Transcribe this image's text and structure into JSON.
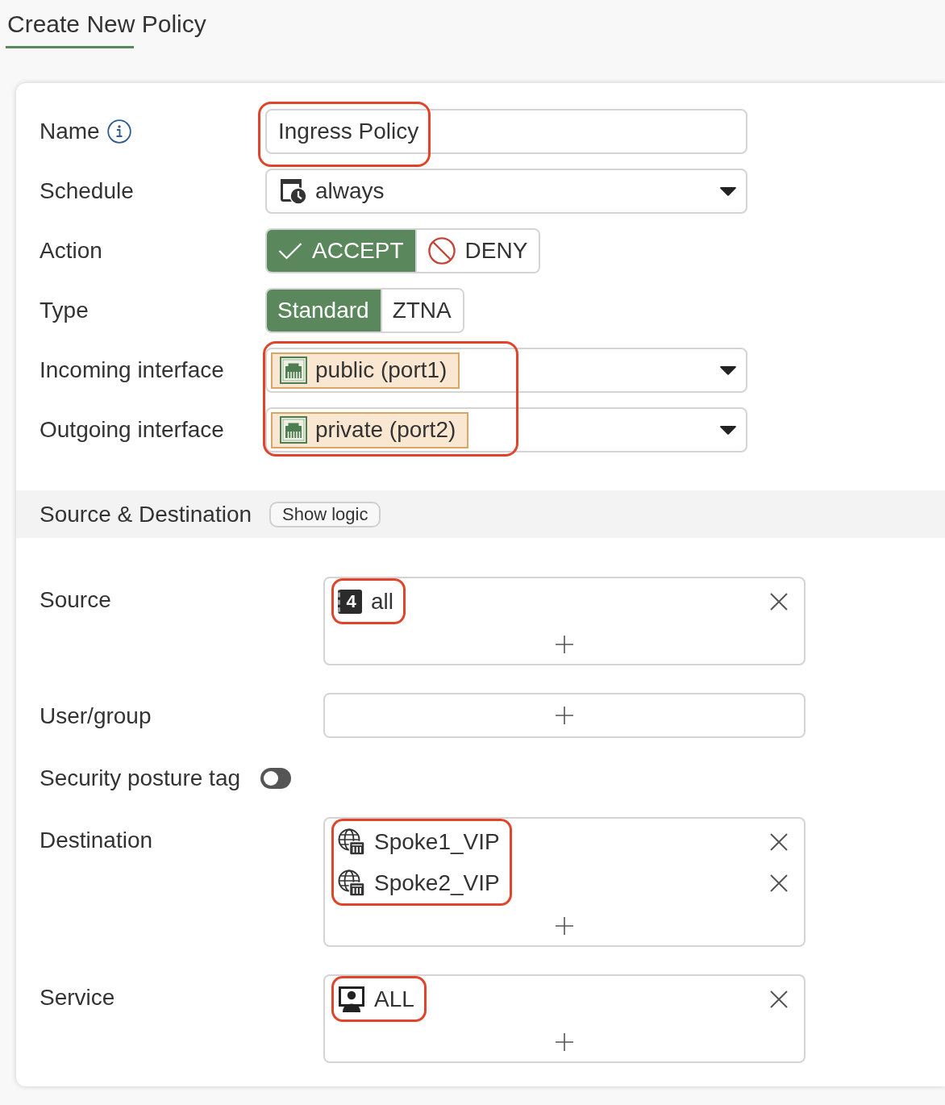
{
  "page": {
    "title": "Create New Policy"
  },
  "general": {
    "fields": [
      {
        "kind": "text",
        "label": "Name",
        "info": true,
        "value": "Ingress Policy",
        "highlighted": true
      },
      {
        "kind": "select",
        "label": "Schedule",
        "value": "always"
      },
      {
        "kind": "segmented",
        "label": "Action",
        "options": [
          {
            "kind": "accept",
            "label": "ACCEPT",
            "selected": true
          },
          {
            "kind": "deny",
            "label": "DENY",
            "selected": false
          }
        ]
      },
      {
        "kind": "segmented",
        "label": "Type",
        "options": [
          {
            "label": "Standard",
            "selected": true
          },
          {
            "label": "ZTNA",
            "selected": false
          }
        ]
      }
    ],
    "interfaces": {
      "highlighted": true,
      "rows": [
        {
          "label": "Incoming interface",
          "value": "public (port1)"
        },
        {
          "label": "Outgoing interface",
          "value": "private (port2)"
        }
      ]
    }
  },
  "section": {
    "title": "Source & Destination",
    "button": "Show logic",
    "fields": [
      {
        "kind": "list",
        "label": "Source",
        "highlighted": true,
        "entries": [
          {
            "kind": "address",
            "badge": "4",
            "label": "all"
          }
        ]
      },
      {
        "kind": "list",
        "label": "User/group"
      },
      {
        "kind": "toggle",
        "label": "Security posture tag",
        "on": false
      },
      {
        "kind": "list",
        "label": "Destination",
        "highlighted": true,
        "entries": [
          {
            "kind": "vip",
            "label": "Spoke1_VIP"
          },
          {
            "kind": "vip",
            "label": "Spoke2_VIP"
          }
        ]
      },
      {
        "kind": "list",
        "label": "Service",
        "highlighted": true,
        "entries": [
          {
            "kind": "service",
            "label": "ALL"
          }
        ]
      }
    ]
  }
}
